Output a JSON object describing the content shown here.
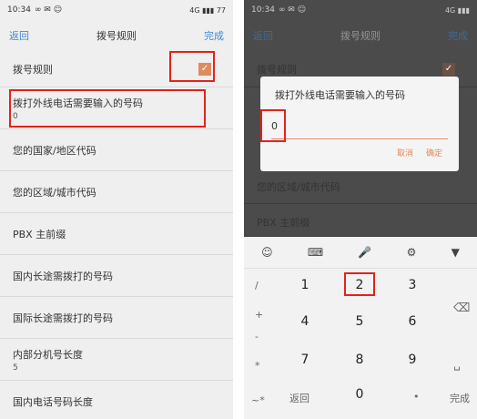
{
  "left": {
    "status": {
      "time": "10:34",
      "signal": "4G ▮▮▮ 77"
    },
    "topbar": {
      "back": "返回",
      "title": "拨号规则",
      "done": "完成"
    },
    "rows": [
      {
        "label": "拨号规则",
        "sub": ""
      },
      {
        "label": "拨打外线电话需要输入的号码",
        "sub": "0"
      },
      {
        "label": "您的国家/地区代码",
        "sub": ""
      },
      {
        "label": "您的区域/城市代码",
        "sub": ""
      },
      {
        "label": "PBX 主前缀",
        "sub": ""
      },
      {
        "label": "国内长途需拨打的号码",
        "sub": ""
      },
      {
        "label": "国际长途需拨打的号码",
        "sub": ""
      },
      {
        "label": "内部分机号长度",
        "sub": "5"
      },
      {
        "label": "国内电话号码长度",
        "sub": ""
      }
    ],
    "checkbox_color": "#e08a5e"
  },
  "right": {
    "status": {
      "time": "10:34",
      "signal": "4G ▮▮▮"
    },
    "topbar": {
      "back": "返回",
      "title": "拨号规则",
      "done": "完成"
    },
    "bg_rows": [
      "拨号规则",
      "您的区域/城市代码",
      "PBX 主前缀"
    ],
    "dialog": {
      "title": "拨打外线电话需要输入的号码",
      "value": "0",
      "cancel": "取消",
      "ok": "确定"
    },
    "keyboard": {
      "toolbar": [
        "☺",
        "⌨",
        "🎤",
        "⚙",
        "▼"
      ],
      "left_symbols": [
        "/",
        "+",
        "-",
        "*",
        "~*"
      ],
      "digits": [
        "1",
        "2",
        "3",
        "4",
        "5",
        "6",
        "7",
        "8",
        "9",
        "0"
      ],
      "back_label": "返回",
      "dot": "•",
      "done_label": "完成",
      "delete": "⌫",
      "space": "␣"
    }
  },
  "colors": {
    "accent": "#3b8ad6",
    "highlight": "#e2231a",
    "orange": "#e08a5e"
  }
}
